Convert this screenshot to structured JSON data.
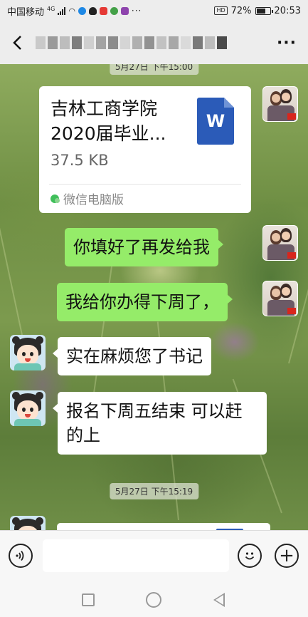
{
  "status_bar": {
    "carrier": "中国移动",
    "network_badge": "4G",
    "battery_percent": "72%",
    "battery_level": 0.72,
    "time": "20:53"
  },
  "header": {
    "back_icon": "chevron-left-icon",
    "more_icon": "more-dots-icon",
    "more_label": "···"
  },
  "messages": {
    "top_timestamp": "5月27日 下午15:00",
    "file": {
      "name": "吉林工商学院2020届毕业...",
      "size": "37.5 KB",
      "source": "微信电脑版",
      "icon_label": "W"
    },
    "m1": "你填好了再发给我",
    "m2": "我给你办得下周了，",
    "m3": "实在麻烦您了书记",
    "m4": "报名下周五结束 可以赶的上",
    "mid_timestamp": "5月27日 下午15:19"
  },
  "input_bar": {
    "voice_icon": "voice-icon",
    "emoji_icon": "emoji-icon",
    "plus_icon": "plus-icon",
    "plus_label": "+"
  },
  "nav_bar": {
    "recent_icon": "square-icon",
    "home_icon": "circle-icon",
    "back_icon": "triangle-back-icon"
  },
  "colors": {
    "outgoing_bubble": "#95ec69",
    "incoming_bubble": "#ffffff",
    "bar_background": "#ededed",
    "word_blue": "#2b5bb8"
  }
}
